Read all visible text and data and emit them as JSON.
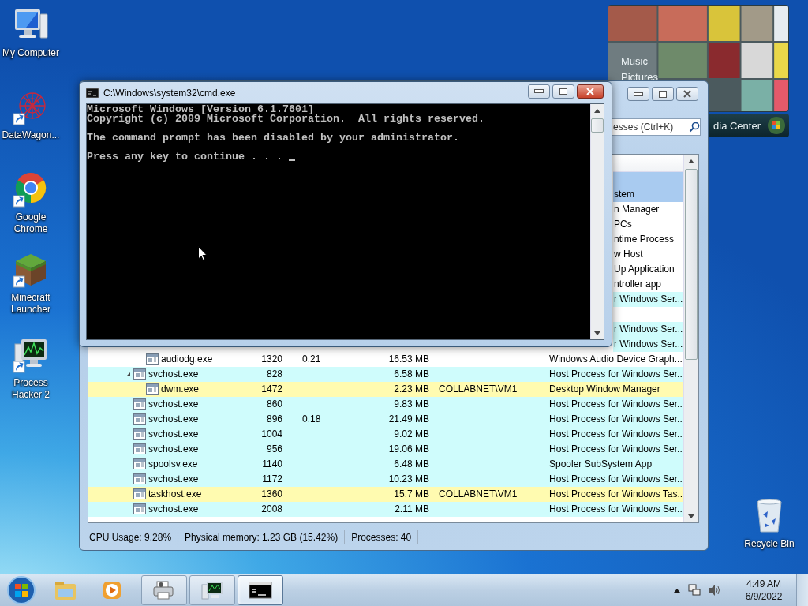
{
  "desktop_icons": [
    {
      "label": "My Computer",
      "kind": "computer",
      "shortcut": false
    },
    {
      "label": "DataWagon...",
      "kind": "network",
      "shortcut": true
    },
    {
      "label": "Google Chrome",
      "kind": "browser",
      "shortcut": true
    },
    {
      "label": "Minecraft Launcher",
      "kind": "block",
      "shortcut": true
    },
    {
      "label": "Process Hacker 2",
      "kind": "monitor",
      "shortcut": true
    }
  ],
  "recycle_bin": {
    "label": "Recycle Bin"
  },
  "media_center_gadget": {
    "menu_items": [
      "Music",
      "Pictures"
    ],
    "title": "dia Center"
  },
  "process_hacker_window": {
    "search": {
      "placeholder": "esses (Ctrl+K)"
    },
    "rows": [
      {
        "kind": "partly_hidden",
        "selected": true
      },
      {
        "kind": "partly_hidden",
        "selected": true,
        "description": "stem"
      },
      {
        "kind": "partly_hidden",
        "selected": false,
        "color": "#ffffff",
        "description": "n Manager"
      },
      {
        "kind": "partly_hidden",
        "selected": false,
        "color": "#ffffff",
        "description": "PCs"
      },
      {
        "kind": "partly_hidden",
        "selected": false,
        "color": "#ffffff",
        "description": "ntime Process"
      },
      {
        "kind": "partly_hidden",
        "selected": false,
        "color": "#ffffff",
        "description": "w Host"
      },
      {
        "kind": "partly_hidden",
        "selected": false,
        "color": "#ffffff",
        "description": "Up Application"
      },
      {
        "kind": "partly_hidden",
        "selected": false,
        "color": "#ffffff",
        "description": "ntroller app"
      },
      {
        "kind": "partly_hidden",
        "selected": false,
        "color": "#cffcfc",
        "description": "r Windows Ser..."
      },
      {
        "kind": "partly_hidden",
        "selected": false
      },
      {
        "kind": "partly_hidden",
        "selected": false,
        "color": "#cffcfc",
        "description": "r Windows Ser..."
      },
      {
        "kind": "partly_hidden",
        "selected": false,
        "color": "#cffcfc",
        "description": "r Windows Ser...",
        "children": [
          {
            "kind": "process",
            "selected": false,
            "color": "#ffffff",
            "name": "audiodg.exe",
            "pid": "1320",
            "cpu": "0.21",
            "memory": "16.53 MB",
            "description": "Windows Audio Device Graph..."
          }
        ]
      },
      {
        "kind": "process",
        "selected": false,
        "color": "#cffcfc",
        "name": "svchost.exe",
        "pid": "828",
        "memory": "6.58 MB",
        "description": "Host Process for Windows Ser...",
        "expanded": true,
        "children": [
          {
            "kind": "process",
            "selected": false,
            "color": "#fffbb0",
            "name": "dwm.exe",
            "pid": "1472",
            "memory": "2.23 MB",
            "user": "COLLABNET\\VM1",
            "description": "Desktop Window Manager"
          }
        ]
      },
      {
        "kind": "process",
        "selected": false,
        "color": "#cffcfc",
        "name": "svchost.exe",
        "pid": "860",
        "memory": "9.83 MB",
        "description": "Host Process for Windows Ser..."
      },
      {
        "kind": "process",
        "selected": false,
        "color": "#cffcfc",
        "name": "svchost.exe",
        "pid": "896",
        "cpu": "0.18",
        "memory": "21.49 MB",
        "description": "Host Process for Windows Ser..."
      },
      {
        "kind": "process",
        "selected": false,
        "color": "#cffcfc",
        "name": "svchost.exe",
        "pid": "1004",
        "memory": "9.02 MB",
        "description": "Host Process for Windows Ser..."
      },
      {
        "kind": "process",
        "selected": false,
        "color": "#cffcfc",
        "name": "svchost.exe",
        "pid": "956",
        "memory": "19.06 MB",
        "description": "Host Process for Windows Ser..."
      },
      {
        "kind": "process",
        "selected": false,
        "color": "#cffcfc",
        "name": "spoolsv.exe",
        "pid": "1140",
        "memory": "6.48 MB",
        "description": "Spooler SubSystem App"
      },
      {
        "kind": "process",
        "selected": false,
        "color": "#cffcfc",
        "name": "svchost.exe",
        "pid": "1172",
        "memory": "10.23 MB",
        "description": "Host Process for Windows Ser..."
      },
      {
        "kind": "process",
        "selected": false,
        "color": "#fffbb0",
        "name": "taskhost.exe",
        "pid": "1360",
        "memory": "15.7 MB",
        "user": "COLLABNET\\VM1",
        "description": "Host Process for Windows Tas..."
      },
      {
        "kind": "process",
        "selected": false,
        "color": "#cffcfc",
        "name": "svchost.exe",
        "pid": "2008",
        "memory": "2.11 MB",
        "description": "Host Process for Windows Ser..."
      }
    ],
    "status_bar": [
      "CPU Usage: 9.28%",
      "Physical memory: 1.23 GB (15.42%)",
      "Processes: 40"
    ]
  },
  "cmd_window": {
    "title": "C:\\Windows\\system32\\cmd.exe",
    "paragraphs": [
      [
        "Microsoft Windows [Version 6.1.7601]",
        "Copyright (c) 2009 Microsoft Corporation.  All rights reserved."
      ],
      [
        "The command prompt has been disabled by your administrator."
      ],
      [
        "Press any key to continue . . ."
      ]
    ]
  },
  "taskbar": {
    "pinned": [
      {
        "kind": "folders"
      },
      {
        "kind": "player"
      }
    ],
    "tasks": [
      {
        "kind": "printer",
        "selected": false
      },
      {
        "kind": "monitor",
        "selected": false
      },
      {
        "kind": "console",
        "selected": true
      }
    ],
    "clock": {
      "time": "4:49 AM",
      "date": "6/9/2022"
    }
  }
}
